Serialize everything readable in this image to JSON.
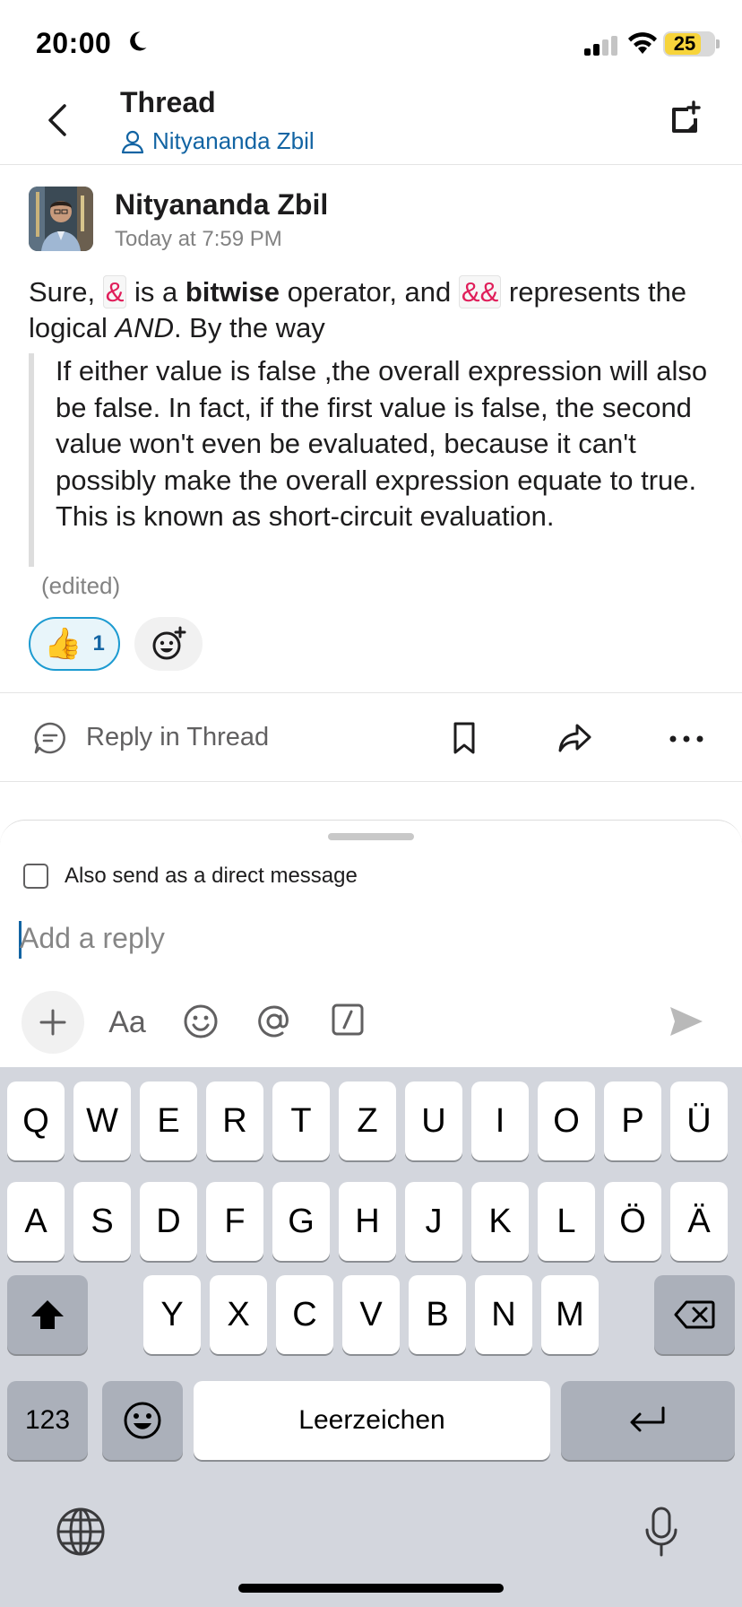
{
  "status_bar": {
    "time": "20:00",
    "battery": "25",
    "icons": [
      "moon-icon",
      "signal-icon",
      "wifi-icon",
      "battery-icon"
    ]
  },
  "header": {
    "title": "Thread",
    "subtitle": "Nityananda Zbil"
  },
  "message": {
    "author": "Nityananda Zbil",
    "timestamp": "Today at 7:59 PM",
    "body": {
      "t1": "Sure, ",
      "code1": "&",
      "t2": " is a ",
      "bold": "bitwise",
      "t3": " operator, and ",
      "code2": "&&",
      "t4": " represents the logical ",
      "italic": "AND",
      "t5": ". By the way"
    },
    "quote": "If either value is false ,the overall expression will also be false. In fact, if the first value is false, the second value won't even be evaluated, because it can't possibly make the overall expression equate to true. This is known as short-circuit evaluation.",
    "edited": "(edited)",
    "reactions": [
      {
        "emoji": "👍",
        "count": "1"
      }
    ]
  },
  "actions": {
    "reply_label": "Reply in Thread"
  },
  "composer": {
    "dm_label": "Also send as a direct message",
    "placeholder": "Add a reply",
    "format_label": "Aa"
  },
  "keyboard": {
    "row1": [
      "Q",
      "W",
      "E",
      "R",
      "T",
      "Z",
      "U",
      "I",
      "O",
      "P",
      "Ü"
    ],
    "row2": [
      "A",
      "S",
      "D",
      "F",
      "G",
      "H",
      "J",
      "K",
      "L",
      "Ö",
      "Ä"
    ],
    "row3": [
      "Y",
      "X",
      "C",
      "V",
      "B",
      "N",
      "M"
    ],
    "numbers_label": "123",
    "space_label": "Leerzeichen"
  },
  "colors": {
    "link": "#1264a3",
    "code": "#e01e5a",
    "reaction_border": "#1d9bd1",
    "battery": "#f7d43b"
  }
}
